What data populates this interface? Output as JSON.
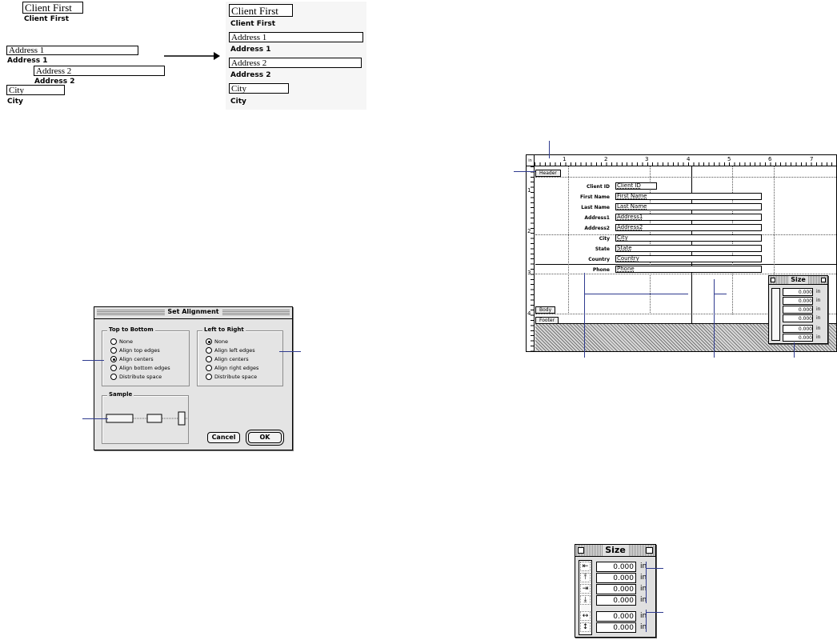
{
  "before_after": {
    "left": {
      "client_first_box": "Client First",
      "client_first_label": "Client First",
      "address1_box": "Address 1",
      "address1_label": "Address 1",
      "address2_box": "Address 2",
      "address2_label": "Address 2",
      "city_box": "City",
      "city_label": "City"
    },
    "right": {
      "client_first_box": "Client First",
      "client_first_label": "Client First",
      "address1_box": "Address 1",
      "address1_label": "Address 1",
      "address2_box": "Address 2",
      "address2_label": "Address 2",
      "city_box": "City",
      "city_label": "City"
    }
  },
  "dialog": {
    "title": "Set Alignment",
    "top_to_bottom": {
      "caption": "Top to Bottom",
      "options": [
        "None",
        "Align top edges",
        "Align centers",
        "Align bottom edges",
        "Distribute space"
      ],
      "selected": "Align centers"
    },
    "left_to_right": {
      "caption": "Left to Right",
      "options": [
        "None",
        "Align left edges",
        "Align centers",
        "Align right edges",
        "Distribute space"
      ],
      "selected": "None"
    },
    "sample_caption": "Sample",
    "cancel_label": "Cancel",
    "ok_label": "OK"
  },
  "layout": {
    "ruler_unit": "in",
    "ruler_top_numbers": [
      "1",
      "2",
      "3",
      "4",
      "5",
      "6",
      "7"
    ],
    "ruler_left_numbers": [
      "1",
      "2",
      "3",
      "4"
    ],
    "header_tab": "Header",
    "body_tab": "Body",
    "footer_tab": "Footer",
    "fields": [
      {
        "label": "Client ID",
        "value": "Client ID"
      },
      {
        "label": "First Name",
        "value": "First Name"
      },
      {
        "label": "Last Name",
        "value": "Last Name"
      },
      {
        "label": "Address1",
        "value": "Address1"
      },
      {
        "label": "Address2",
        "value": "Address2"
      },
      {
        "label": "City",
        "value": "City"
      },
      {
        "label": "State",
        "value": "State"
      },
      {
        "label": "Country",
        "value": "Country"
      },
      {
        "label": "Phone",
        "value": "Phone"
      }
    ]
  },
  "size_palette": {
    "title": "Size",
    "unit": "in",
    "values": [
      "0.000",
      "0.000",
      "0.000",
      "0.000",
      "0.000",
      "0.000"
    ],
    "icons": [
      "left-edge-icon",
      "top-edge-icon",
      "right-edge-icon",
      "bottom-edge-icon",
      "width-icon",
      "height-icon"
    ],
    "icon_glyphs": [
      "⇤",
      "⤒",
      "⇥",
      "⤓",
      "↔",
      "↕"
    ]
  },
  "callout_color": "#2f3b8f"
}
